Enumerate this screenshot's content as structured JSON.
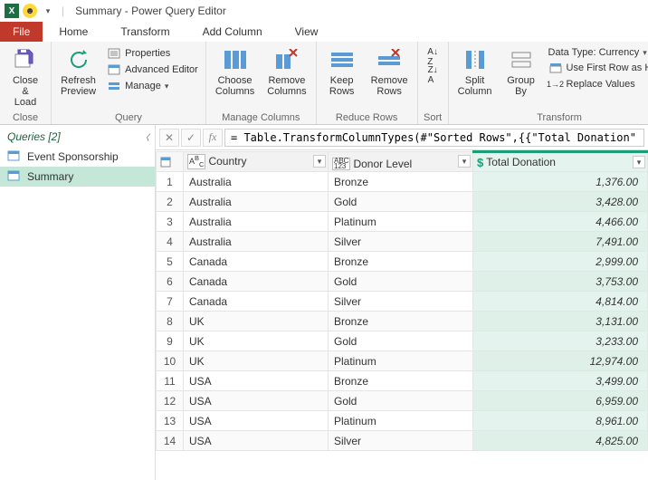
{
  "title": "Summary - Power Query Editor",
  "tabs": {
    "file": "File",
    "home": "Home",
    "transform": "Transform",
    "addcol": "Add Column",
    "view": "View"
  },
  "ribbon": {
    "close": {
      "btn": "Close &\nLoad",
      "group": "Close"
    },
    "query": {
      "refresh": "Refresh\nPreview",
      "props": "Properties",
      "adv": "Advanced Editor",
      "manage": "Manage",
      "group": "Query"
    },
    "mcols": {
      "choose": "Choose\nColumns",
      "remove": "Remove\nColumns",
      "group": "Manage Columns"
    },
    "rrows": {
      "keep": "Keep\nRows",
      "remove": "Remove\nRows",
      "group": "Reduce Rows"
    },
    "sort": {
      "group": "Sort"
    },
    "transform": {
      "split": "Split\nColumn",
      "groupby": "Group\nBy",
      "dtype": "Data Type: Currency",
      "firstrow": "Use First Row as Hea",
      "replace": "Replace Values",
      "group": "Transform"
    }
  },
  "queries": {
    "header": "Queries [2]",
    "items": [
      "Event Sponsorship",
      "Summary"
    ],
    "selected": 1
  },
  "formula": "= Table.TransformColumnTypes(#\"Sorted Rows\",{{\"Total Donation\",",
  "columns": {
    "c1": "Country",
    "c2": "Donor Level",
    "c3": "Total Donation",
    "t1": "ABC",
    "t2": "ABC\n123"
  },
  "rows": [
    {
      "n": 1,
      "country": "Australia",
      "level": "Bronze",
      "val": "1,376.00"
    },
    {
      "n": 2,
      "country": "Australia",
      "level": "Gold",
      "val": "3,428.00"
    },
    {
      "n": 3,
      "country": "Australia",
      "level": "Platinum",
      "val": "4,466.00"
    },
    {
      "n": 4,
      "country": "Australia",
      "level": "Silver",
      "val": "7,491.00"
    },
    {
      "n": 5,
      "country": "Canada",
      "level": "Bronze",
      "val": "2,999.00"
    },
    {
      "n": 6,
      "country": "Canada",
      "level": "Gold",
      "val": "3,753.00"
    },
    {
      "n": 7,
      "country": "Canada",
      "level": "Silver",
      "val": "4,814.00"
    },
    {
      "n": 8,
      "country": "UK",
      "level": "Bronze",
      "val": "3,131.00"
    },
    {
      "n": 9,
      "country": "UK",
      "level": "Gold",
      "val": "3,233.00"
    },
    {
      "n": 10,
      "country": "UK",
      "level": "Platinum",
      "val": "12,974.00"
    },
    {
      "n": 11,
      "country": "USA",
      "level": "Bronze",
      "val": "3,499.00"
    },
    {
      "n": 12,
      "country": "USA",
      "level": "Gold",
      "val": "6,959.00"
    },
    {
      "n": 13,
      "country": "USA",
      "level": "Platinum",
      "val": "8,961.00"
    },
    {
      "n": 14,
      "country": "USA",
      "level": "Silver",
      "val": "4,825.00"
    }
  ]
}
